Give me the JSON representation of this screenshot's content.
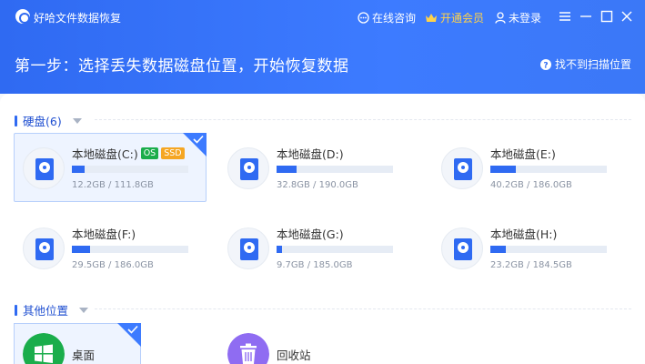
{
  "app": {
    "name": "好哈文件数据恢复"
  },
  "titlebar": {
    "consult_label": "在线咨询",
    "vip_label": "开通会员",
    "login_label": "未登录"
  },
  "header": {
    "step_title": "第一步：选择丢失数据磁盘位置，开始恢复数据",
    "help_label": "找不到扫描位置"
  },
  "sections": {
    "drives_title": "硬盘(6)",
    "places_title": "其他位置"
  },
  "drives": [
    {
      "name": "本地磁盘(C:)",
      "size": "12.2GB / 111.8GB",
      "used_fraction": 0.11,
      "badges": [
        "OS",
        "SSD"
      ],
      "selected": true
    },
    {
      "name": "本地磁盘(D:)",
      "size": "32.8GB / 190.0GB",
      "used_fraction": 0.17,
      "badges": [],
      "selected": false
    },
    {
      "name": "本地磁盘(E:)",
      "size": "40.2GB / 186.0GB",
      "used_fraction": 0.22,
      "badges": [],
      "selected": false
    },
    {
      "name": "本地磁盘(F:)",
      "size": "29.5GB / 186.0GB",
      "used_fraction": 0.16,
      "badges": [],
      "selected": false
    },
    {
      "name": "本地磁盘(G:)",
      "size": "9.7GB / 185.0GB",
      "used_fraction": 0.05,
      "badges": [],
      "selected": false
    },
    {
      "name": "本地磁盘(H:)",
      "size": "23.2GB / 184.5GB",
      "used_fraction": 0.13,
      "badges": [],
      "selected": false
    }
  ],
  "places": [
    {
      "name": "桌面",
      "icon": "windows-icon",
      "selected": true
    },
    {
      "name": "回收站",
      "icon": "trash-icon",
      "selected": false
    }
  ],
  "colors": {
    "accent": "#2f6af2",
    "os_badge": "#1aad4b",
    "ssd_badge": "#f5a623",
    "vip": "#ffd24a"
  }
}
